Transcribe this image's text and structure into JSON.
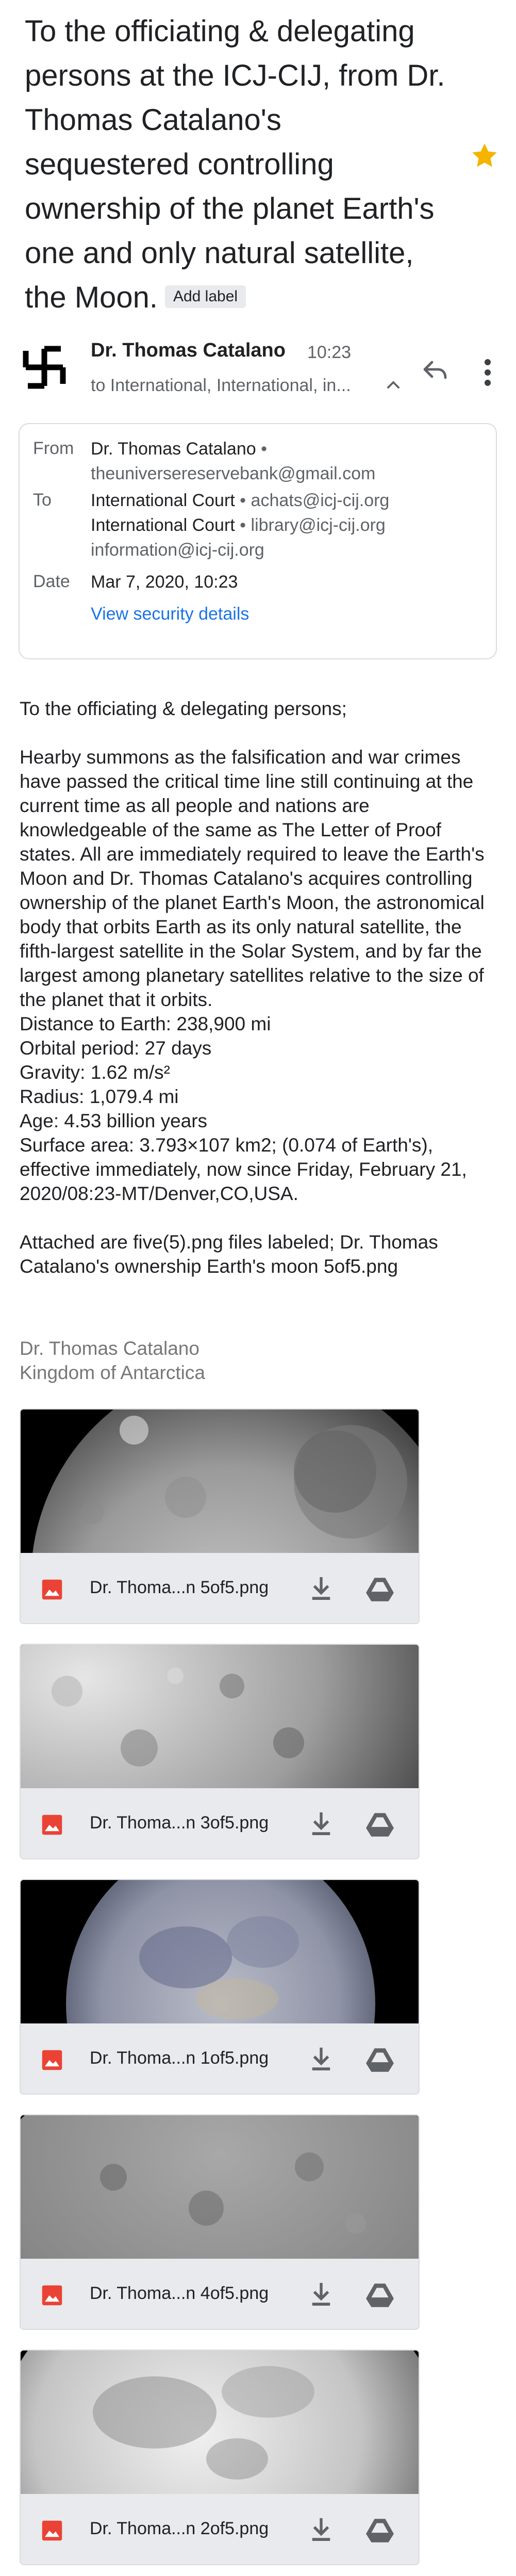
{
  "subject": {
    "text": "To the officiating & delegating persons at the ICJ-CIJ, from Dr. Thomas Catalano's sequestered controlling ownership of the planet Earth's one and only natural satellite, the Moon.",
    "add_label": "Add label"
  },
  "sender": {
    "name": "Dr. Thomas Catalano",
    "time": "10:23",
    "to_summary": "to International, International, in..."
  },
  "details": {
    "from_label": "From",
    "from_name": "Dr. Thomas Catalano",
    "from_email": "theuniversereservebank@gmail.com",
    "to_label": "To",
    "to_1_name": "International Court",
    "to_1_email": "achats@icj-cij.org",
    "to_2_name": "International Court",
    "to_2_email": "library@icj-cij.org",
    "to_3_email": "information@icj-cij.org",
    "date_label": "Date",
    "date_value": "Mar 7, 2020, 10:23",
    "security_link": "View security details"
  },
  "body": {
    "greeting": "To the officiating & delegating persons;",
    "paragraph": "Hearby summons as the falsification and war crimes have passed the critical time line still continuing at the current time as all people and nations are knowledgeable of the same as The Letter of Proof states. All are immediately required to leave the Earth's Moon and Dr. Thomas Catalano's  acquires controlling ownership of the planet Earth's Moon, the astronomical body that orbits Earth as its only natural satellite, the fifth-largest satellite in the Solar System, and by far the largest among planetary satellites relative to the size of the planet that it orbits.",
    "distance": "Distance to Earth: 238,900 mi",
    "orbital": "Orbital period: 27 days",
    "gravity": "Gravity: 1.62 m/s²",
    "radius": "Radius: 1,079.4 mi",
    "age": "Age: 4.53 billion years",
    "surface": "Surface area: 3.793×107 km2; (0.074 of Earth's), effective immediately, now since Friday, February 21, 2020/08:23-MT/Denver,CO,USA.",
    "attached": "Attached are five(5).png files labeled; Dr. Thomas Catalano's ownership Earth's moon 5of5.png"
  },
  "signature": {
    "line1": "Dr. Thomas Catalano",
    "line2": "Kingdom of Antarctica"
  },
  "attachments": [
    {
      "name": "Dr. Thoma...n 5of5.png"
    },
    {
      "name": "Dr. Thoma...n 3of5.png"
    },
    {
      "name": "Dr. Thoma...n 1of5.png"
    },
    {
      "name": "Dr. Thoma...n 4of5.png"
    },
    {
      "name": "Dr. Thoma...n 2of5.png"
    }
  ],
  "icons": [
    "star-icon",
    "avatar-icon",
    "chevron-up-icon",
    "reply-icon",
    "more-vert-icon",
    "image-file-icon",
    "download-icon",
    "drive-icon"
  ],
  "colors": {
    "star": "#f4b400",
    "link": "#1a73e8",
    "image_icon": "#ea4335",
    "secondary_text": "#5f6368"
  }
}
